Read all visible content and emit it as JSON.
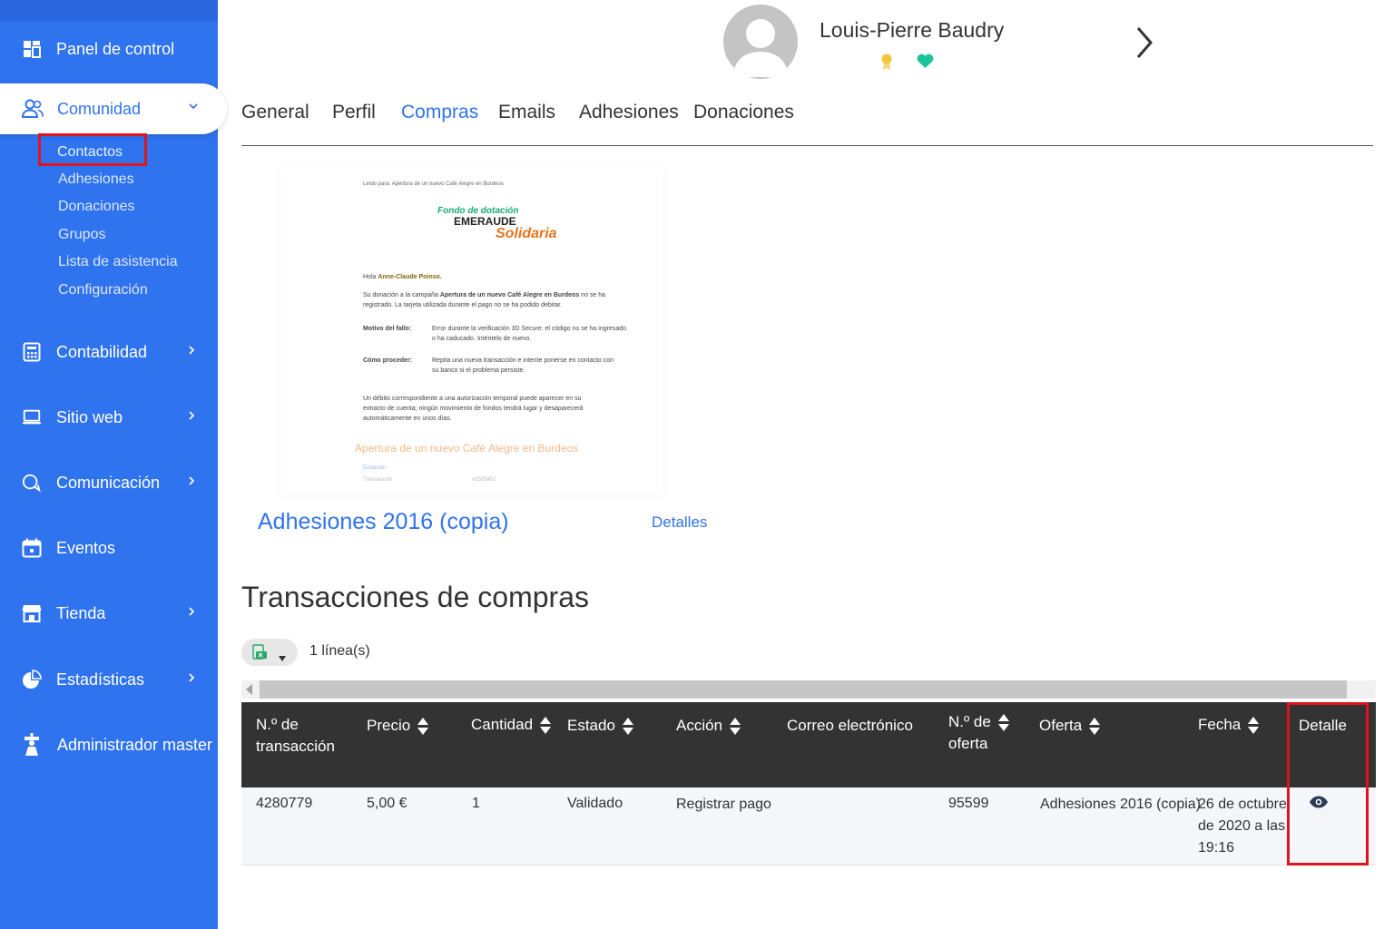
{
  "sidebar": {
    "items": [
      {
        "label": "Panel de control",
        "icon": "dashboard-icon"
      },
      {
        "label": "Comunidad",
        "icon": "community-icon"
      },
      {
        "label": "Contabilidad",
        "icon": "calculator-icon"
      },
      {
        "label": "Sitio web",
        "icon": "laptop-icon"
      },
      {
        "label": "Comunicación",
        "icon": "chat-icon"
      },
      {
        "label": "Eventos",
        "icon": "calendar-icon"
      },
      {
        "label": "Tienda",
        "icon": "store-icon"
      },
      {
        "label": "Estadísticas",
        "icon": "pie-chart-icon"
      },
      {
        "label": "Administrador master",
        "icon": "admin-icon"
      }
    ],
    "sub_items": [
      "Contactos",
      "Adhesiones",
      "Donaciones",
      "Grupos",
      "Lista de asistencia",
      "Configuración"
    ]
  },
  "header": {
    "user_name": "Louis-Pierre Baudry"
  },
  "tabs": [
    {
      "label": "General"
    },
    {
      "label": "Perfil"
    },
    {
      "label": "Compras"
    },
    {
      "label": "Emails"
    },
    {
      "label": "Adhesiones"
    },
    {
      "label": "Donaciones"
    }
  ],
  "preview": {
    "read_for": "Leído para: Apertura de un nuevo Café Alegre en Burdeos",
    "logo_line1": "Fondo de dotación",
    "logo_line2": "EMERAUDE",
    "logo_line3": "Solidaria",
    "greeting_prefix": "Hola ",
    "greeting_name": "Anne-Claude Poinso.",
    "p1_a": "Su donación a la campaña ",
    "p1_b": "Apertura de un nuevo Café Alegre en Burdeos",
    "p1_c": " no se ha",
    "p1_d": "registrado. La tarjeta utilizada durante el pago no se ha podido debitar.",
    "reason_label": "Motivo del fallo:",
    "reason_1": "Error durante la verificación 3D Secure: el código no se ha ingresado",
    "reason_2": "o ha caducado. Inténtelo de nuevo.",
    "how_label": "Cómo proceder:",
    "how_1": "Repita una nueva transacción e intente ponerse en contacto con",
    "how_2": "su banco si el problema persiste.",
    "p3_1": "Un débito correspondiente a una autorización temporal puede aparecer en su",
    "p3_2": "extracto de cuenta; ningún movimiento de fondos tendrá lugar y desaparecerá",
    "p3_3": "automáticamente en unos días.",
    "campaign": "Apertura de un nuevo Café Alegre en Burdeos",
    "donation_label": "Donación",
    "transaction_label": "Transacción",
    "transaction_id": "#2555492"
  },
  "offer": {
    "title": "Adhesiones 2016 (copia)",
    "details_link": "Detalles"
  },
  "transactions": {
    "title": "Transacciones de compras",
    "line_count": "1 línea(s)",
    "columns": {
      "id_1": "N.º de",
      "id_2": "transacción",
      "price": "Precio",
      "qty": "Cantidad",
      "status": "Estado",
      "action": "Acción",
      "email": "Correo electrónico",
      "offer_no_1": "N.º de",
      "offer_no_2": "oferta",
      "offer": "Oferta",
      "date": "Fecha",
      "detail": "Detalle"
    },
    "rows": [
      {
        "id": "4280779",
        "price": "5,00 €",
        "qty": "1",
        "status": "Validado",
        "action": "Registrar pago",
        "email": "",
        "offer_no": "95599",
        "offer": "Adhesiones 2016 (copia)",
        "date_1": "26 de octubre",
        "date_2": "de 2020 a las",
        "date_3": "19:16"
      }
    ]
  },
  "colors": {
    "sidebar": "#2f73ef",
    "accent": "#2f73ef",
    "table_header": "#333333",
    "highlight": "#e0141e",
    "heart": "#1bc39a",
    "medal": "#f2c53d"
  }
}
